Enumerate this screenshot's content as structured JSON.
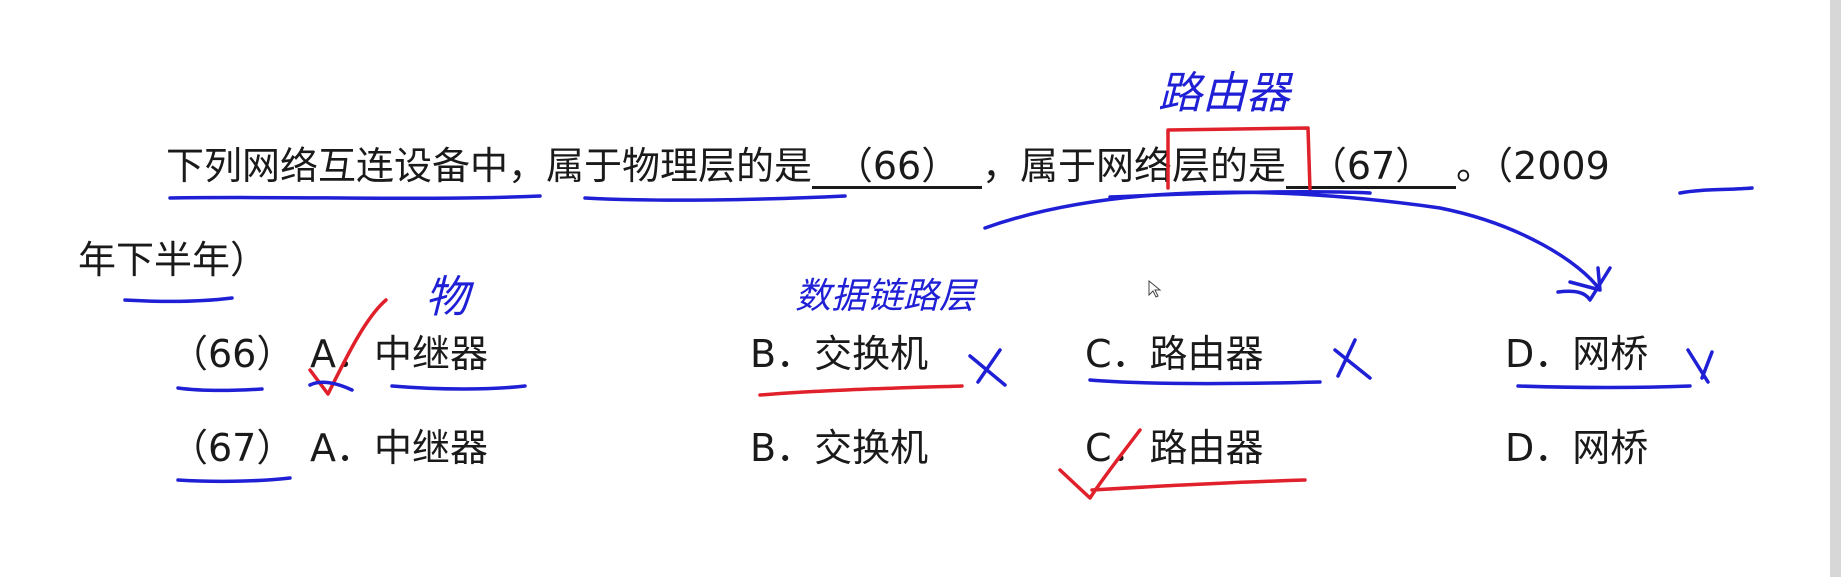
{
  "question": {
    "line1_part1": "下列网络互连设备中，",
    "line1_part2": "属于物理层的是",
    "blank1": "（66）",
    "line1_part3": "，属于网络层的是",
    "blank2": "（67）",
    "line1_part4": "。（",
    "year": "2009",
    "line2": "年下半年）"
  },
  "rows": [
    {
      "num": "（66）",
      "options": [
        {
          "letter": "A．",
          "text": "中继器"
        },
        {
          "letter": "B．",
          "text": "交换机"
        },
        {
          "letter": "C．",
          "text": "路由器"
        },
        {
          "letter": "D．",
          "text": "网桥"
        }
      ]
    },
    {
      "num": "（67）",
      "options": [
        {
          "letter": "A．",
          "text": "中继器"
        },
        {
          "letter": "B．",
          "text": "交换机"
        },
        {
          "letter": "C．",
          "text": "路由器"
        },
        {
          "letter": "D．",
          "text": "网桥"
        }
      ]
    }
  ],
  "annotations": {
    "router_note": "路由器",
    "physical_note": "物",
    "datalink_note": "数据链路层"
  },
  "colors": {
    "blue_ink": "#1f1fd6",
    "red_ink": "#e0202a",
    "text": "#1a1a1a"
  }
}
